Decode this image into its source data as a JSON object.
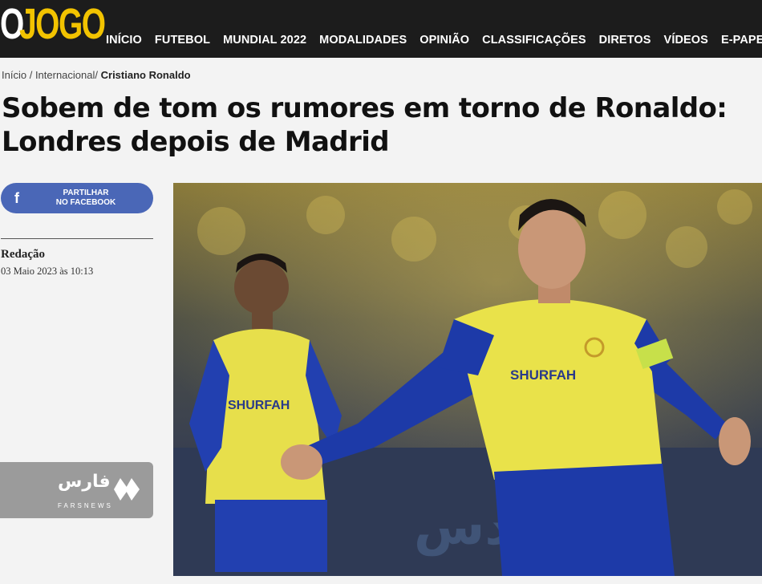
{
  "header": {
    "logo_o": "O",
    "logo_jogo": "JOGO",
    "nav": [
      "INÍCIO",
      "FUTEBOL",
      "MUNDIAL 2022",
      "MODALIDADES",
      "OPINIÃO",
      "CLASSIFICAÇÕES",
      "DIRETOS",
      "VÍDEOS",
      "E-PAPER"
    ]
  },
  "breadcrumb": {
    "home": "Início",
    "section": "Internacional",
    "current": "Cristiano Ronaldo"
  },
  "article": {
    "title": "Sobem de tom os rumores em torno de Ronaldo: Londres depois de Madrid",
    "author": "Redação",
    "date": "03 Maio 2023 às 10:13"
  },
  "share": {
    "icon": "f",
    "line1": "PARTILHAR",
    "line2": "NO FACEBOOK"
  },
  "photo": {
    "shirt_text": "SHURFAH",
    "watermark_fa": "فارس",
    "watermark_en": "FARSNEWS"
  },
  "colors": {
    "header_bg": "#1c1c1c",
    "logo_yellow": "#f2c300",
    "facebook_blue": "#4a67b7",
    "kit_yellow": "#e9e24a",
    "kit_blue": "#1d3aa8"
  }
}
